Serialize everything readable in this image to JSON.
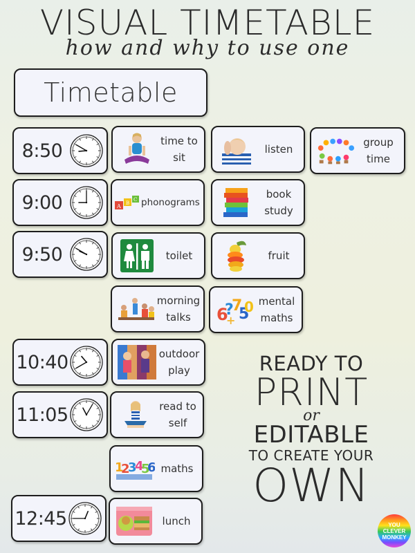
{
  "title": "VISUAL TIMETABLE",
  "subtitle": "how and why to use one",
  "header_card": "Timetable",
  "times": [
    {
      "label": "8:50",
      "hour": 8,
      "minute": 50
    },
    {
      "label": "9:00",
      "hour": 9,
      "minute": 0
    },
    {
      "label": "9:50",
      "hour": 9,
      "minute": 50
    },
    {
      "label": "10:40",
      "hour": 10,
      "minute": 40
    },
    {
      "label": "11:05",
      "hour": 11,
      "minute": 5
    },
    {
      "label": "12:45",
      "hour": 12,
      "minute": 45
    }
  ],
  "activities": [
    {
      "label_1": "time to",
      "label_2": "sit",
      "icon": "child-sitting-icon"
    },
    {
      "label_1": "listen",
      "label_2": "",
      "icon": "child-listening-icon"
    },
    {
      "label_1": "group",
      "label_2": "time",
      "icon": "group-figures-icon"
    },
    {
      "label_1": "phonograms",
      "label_2": "",
      "icon": "abc-blocks-icon"
    },
    {
      "label_1": "book",
      "label_2": "study",
      "icon": "book-stack-icon"
    },
    {
      "label_1": "toilet",
      "label_2": "",
      "icon": "toilet-sign-icon"
    },
    {
      "label_1": "fruit",
      "label_2": "",
      "icon": "fruit-icon"
    },
    {
      "label_1": "morning",
      "label_2": "talks",
      "icon": "children-talking-icon"
    },
    {
      "label_1": "mental",
      "label_2": "maths",
      "icon": "number-shapes-icon"
    },
    {
      "label_1": "outdoor",
      "label_2": "play",
      "icon": "children-playing-icon"
    },
    {
      "label_1": "read to",
      "label_2": "self",
      "icon": "child-reading-icon"
    },
    {
      "label_1": "maths",
      "label_2": "",
      "icon": "numbers-icon"
    },
    {
      "label_1": "lunch",
      "label_2": "",
      "icon": "lunchbox-icon"
    }
  ],
  "promo": {
    "line1": "READY TO",
    "line2": "PRINT",
    "line3": "or",
    "line4": "EDITABLE",
    "line5": "TO CREATE YOUR",
    "line6": "OWN"
  },
  "logo": {
    "line1": "YOU",
    "line2": "CLEVER",
    "line3": "MONKEY"
  }
}
